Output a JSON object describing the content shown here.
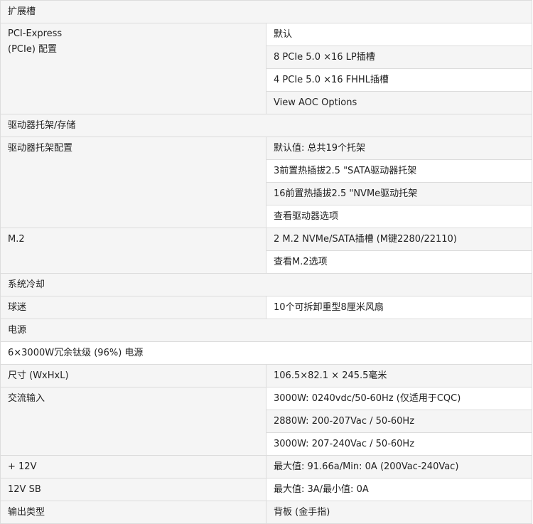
{
  "sections": {
    "expansion": "扩展槽",
    "drives": "驱动器托架/存储",
    "cooling": "系统冷却",
    "power": "电源"
  },
  "pcie": {
    "label_line1": "PCI-Express",
    "label_line2": "(PCIe) 配置",
    "values": [
      "默认",
      "8 PCIe 5.0 ×16 LP插槽",
      "4 PCIe 5.0 ×16 FHHL插槽",
      "View AOC Options"
    ]
  },
  "drive_bays": {
    "label": "驱动器托架配置",
    "values": [
      "默认值: 总共19个托架",
      "3前置热插拔2.5 \"SATA驱动器托架",
      "16前置热插拔2.5 \"NVMe驱动托架",
      "查看驱动器选项"
    ]
  },
  "m2": {
    "label": "M.2",
    "values": [
      "2 M.2 NVMe/SATA插槽 (M键2280/22110)",
      "查看M.2选项"
    ]
  },
  "fans": {
    "label": "球迷",
    "value": "10个可拆卸重型8厘米风扇"
  },
  "psu": {
    "full": "6×3000W冗余钛级 (96%) 电源"
  },
  "dimensions": {
    "label": "尺寸 (WxHxL)",
    "value": "106.5×82.1 × 245.5毫米"
  },
  "ac_input": {
    "label": "交流输入",
    "values": [
      "3000W: 0240vdc/50-60Hz (仅适用于CQC)",
      "2880W: 200-207Vac / 50-60Hz",
      "3000W: 207-240Vac / 50-60Hz"
    ]
  },
  "plus12v": {
    "label": "+ 12V",
    "value": "最大值: 91.66a/Min: 0A (200Vac-240Vac)"
  },
  "sb12v": {
    "label": "12V SB",
    "value": "最大值: 3A/最小值: 0A"
  },
  "output_type": {
    "label": "输出类型",
    "value": "背板 (金手指)"
  }
}
